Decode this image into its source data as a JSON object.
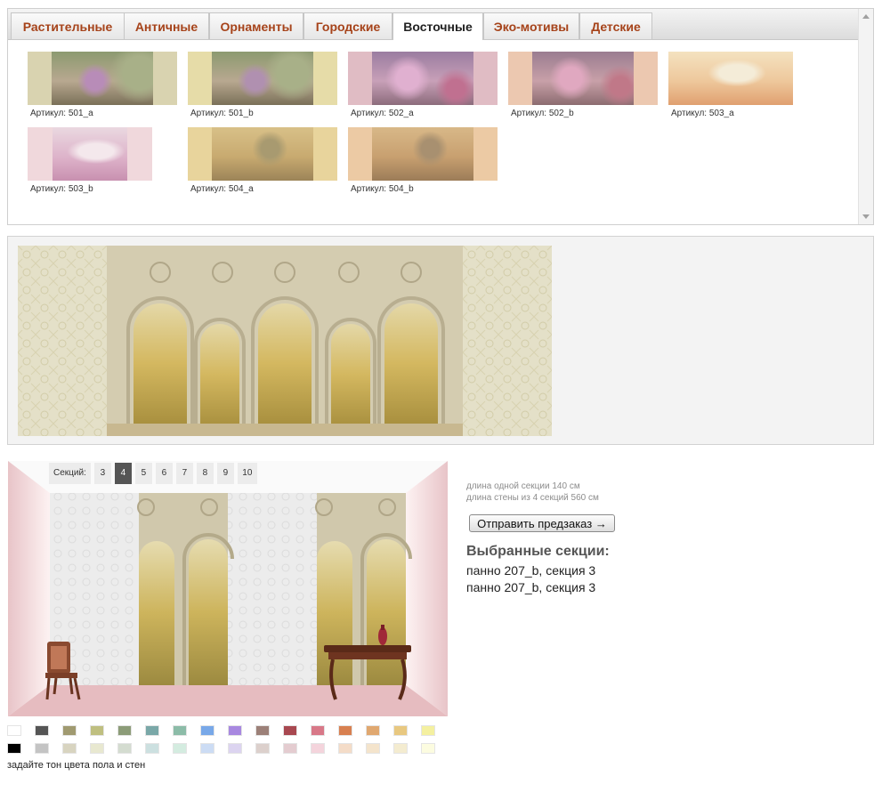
{
  "catalog": {
    "tabs": [
      {
        "label": "Растительные",
        "active": false
      },
      {
        "label": "Античные",
        "active": false
      },
      {
        "label": "Орнаменты",
        "active": false
      },
      {
        "label": "Городские",
        "active": false
      },
      {
        "label": "Восточные",
        "active": true
      },
      {
        "label": "Эко-мотивы",
        "active": false
      },
      {
        "label": "Детские",
        "active": false
      }
    ],
    "items": [
      {
        "caption": "Артикул: 501_a"
      },
      {
        "caption": "Артикул: 501_b"
      },
      {
        "caption": "Артикул: 502_a"
      },
      {
        "caption": "Артикул: 502_b"
      },
      {
        "caption": "Артикул: 503_a"
      },
      {
        "caption": "Артикул: 503_b"
      },
      {
        "caption": "Артикул: 504_a"
      },
      {
        "caption": "Артикул: 504_b"
      }
    ]
  },
  "room": {
    "sections_label": "Секций:",
    "section_options": [
      "3",
      "4",
      "5",
      "6",
      "7",
      "8",
      "9",
      "10"
    ],
    "selected_sections": "4"
  },
  "info": {
    "section_length": "длина одной секции 140 см",
    "wall_length": "длина стены из 4 секций 560 см",
    "order_button": "Отправить предзаказ →",
    "selected_title": "Выбранные секции:",
    "selected_items": [
      "панно 207_b, секция 3",
      "панно 207_b, секция 3"
    ]
  },
  "palette": {
    "row1": [
      "#ffffff",
      "#555555",
      "#a09a70",
      "#bfbf80",
      "#8c9c78",
      "#7aa8a8",
      "#8cbca8",
      "#78a8e8",
      "#a888e0",
      "#9c8078",
      "#a84850",
      "#d87888",
      "#d88050",
      "#e0a870",
      "#e8c880",
      "#f4f0a0"
    ],
    "row2": [
      "#000000",
      "#c4c4c4",
      "#d8d4c0",
      "#e8e8d0",
      "#d4dcd0",
      "#cce0e0",
      "#d4ece0",
      "#ccdcf4",
      "#dcd4f0",
      "#dcd0cc",
      "#e4ccd0",
      "#f4d4dc",
      "#f4dcc8",
      "#f4e4cc",
      "#f4ecd0",
      "#fcfce0"
    ],
    "hint": "задайте тон цвета пола и стен"
  }
}
